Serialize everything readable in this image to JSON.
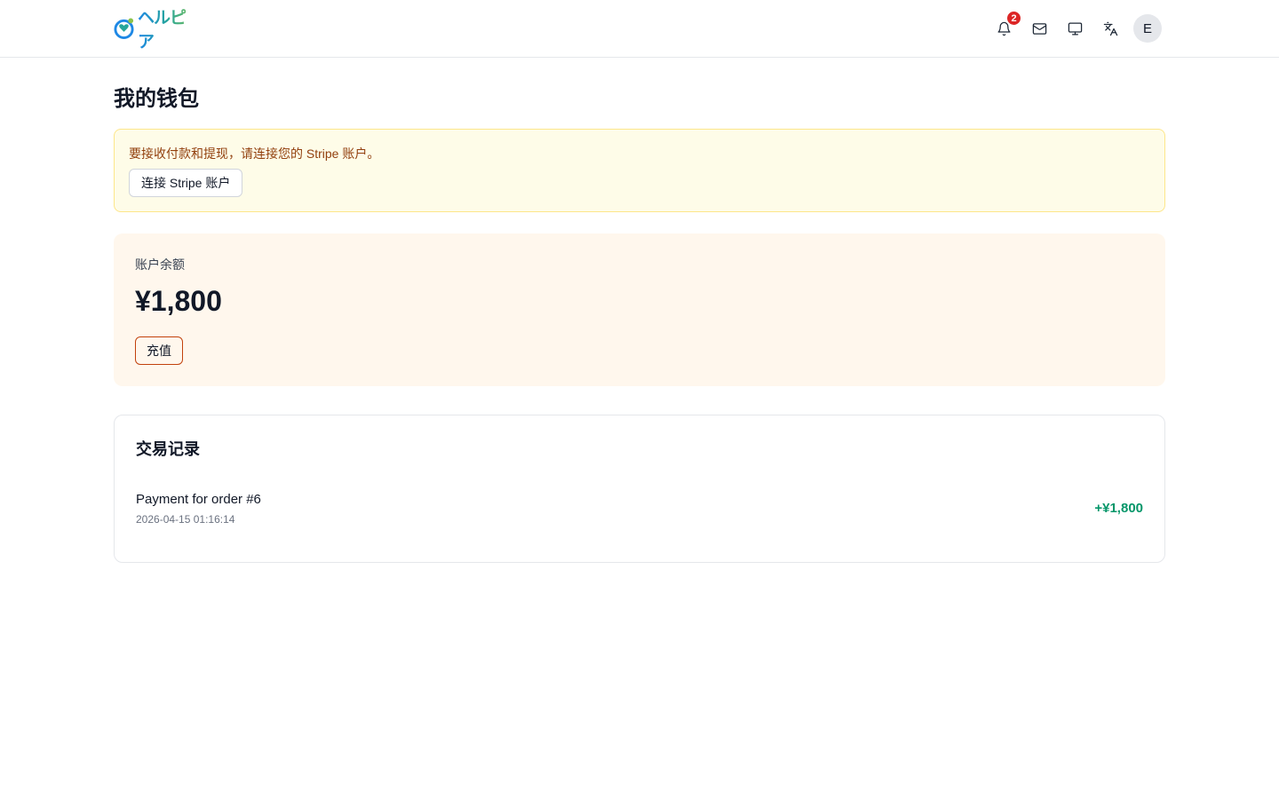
{
  "header": {
    "logo_text": "ヘルピア",
    "notification_count": "2",
    "avatar_initial": "E",
    "icons": [
      "bell-icon",
      "mail-icon",
      "monitor-icon",
      "translate-icon"
    ]
  },
  "page": {
    "title": "我的钱包"
  },
  "stripe_notice": {
    "message": "要接收付款和提现，请连接您的 Stripe 账户。",
    "button_label": "连接 Stripe 账户"
  },
  "balance": {
    "label": "账户余额",
    "amount": "¥1,800",
    "topup_label": "充值"
  },
  "transactions": {
    "title": "交易记录",
    "items": [
      {
        "description": "Payment for order #6",
        "date": "2026-04-15 01:16:14",
        "amount": "+¥1,800"
      }
    ]
  },
  "colors": {
    "notice_bg": "#fefce8",
    "notice_text": "#92400e",
    "balance_bg": "#fff7ed",
    "topup_border": "#c2410c",
    "positive_amount": "#059669",
    "badge": "#dc2626"
  }
}
